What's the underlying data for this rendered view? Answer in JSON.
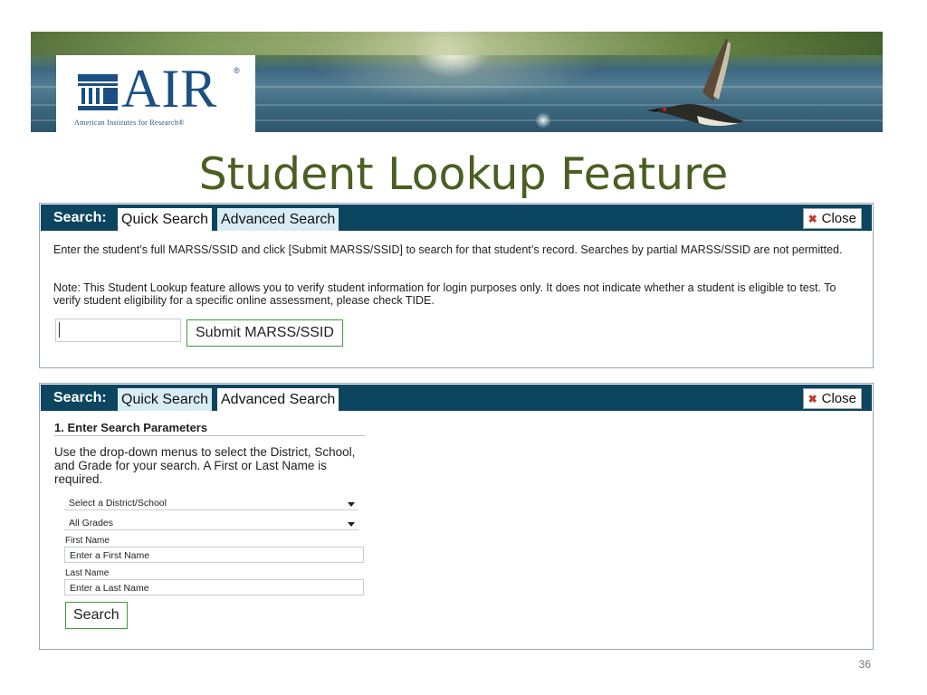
{
  "banner": {
    "logo_text": "AIR",
    "logo_registered": "®",
    "logo_subtitle": "American Institutes for Research®"
  },
  "slide": {
    "title": "Student Lookup Feature",
    "page_number": "36"
  },
  "quick_panel": {
    "search_label": "Search:",
    "tabs": [
      {
        "label": "Quick Search",
        "active": true
      },
      {
        "label": "Advanced Search",
        "active": false
      }
    ],
    "close_label": "Close",
    "instructions": "Enter the student’s full MARSS/SSID and click [Submit MARSS/SSID] to search for that student’s record. Searches by partial MARSS/SSID are not permitted.",
    "note": "Note: This Student Lookup feature allows you to verify student information for login purposes only. It does not indicate whether a student is eligible to test. To verify student eligibility for a specific online assessment, please check TIDE.",
    "ssid_value": "",
    "submit_label": "Submit MARSS/SSID"
  },
  "advanced_panel": {
    "search_label": "Search:",
    "tabs": [
      {
        "label": "Quick Search",
        "active": false
      },
      {
        "label": "Advanced Search",
        "active": true
      }
    ],
    "close_label": "Close",
    "section_title": "1. Enter Search Parameters",
    "instructions": "Use the drop-down menus to select the District, School, and Grade for your search. A First or Last Name is required.",
    "district_select": "Select a District/School",
    "grade_select": "All Grades",
    "first_name_label": "First Name",
    "first_name_value": "Enter a First Name",
    "last_name_label": "Last Name",
    "last_name_value": "Enter a Last Name",
    "search_label_button": "Search"
  },
  "colors": {
    "bar": "#0b4560",
    "title": "#4a5f22",
    "button_border": "#3d9a3d",
    "close_x": "#c0392b"
  }
}
